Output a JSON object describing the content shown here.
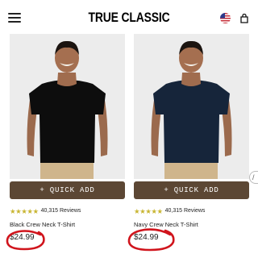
{
  "header": {
    "brand": "TRUE CLASSIC",
    "menu_icon": "hamburger-menu-icon",
    "flag_icon": "us-flag-icon",
    "cart_icon": "shopping-bag-icon"
  },
  "products": [
    {
      "name": "Black Crew Neck T-Shirt",
      "shirt_color": "#0d0d0d",
      "quick_add_label": "+ QUICK ADD",
      "rating": 4.5,
      "reviews": "40,315 Reviews",
      "price": "$24.99"
    },
    {
      "name": "Navy Crew Neck T-Shirt",
      "shirt_color": "#16253a",
      "quick_add_label": "+ QUICK ADD",
      "rating": 4.5,
      "reviews": "40,315 Reviews",
      "price": "$24.99"
    }
  ],
  "colors": {
    "quick_add_bg": "#5c4734",
    "star": "#c8b532",
    "annotation": "#d0141c"
  }
}
